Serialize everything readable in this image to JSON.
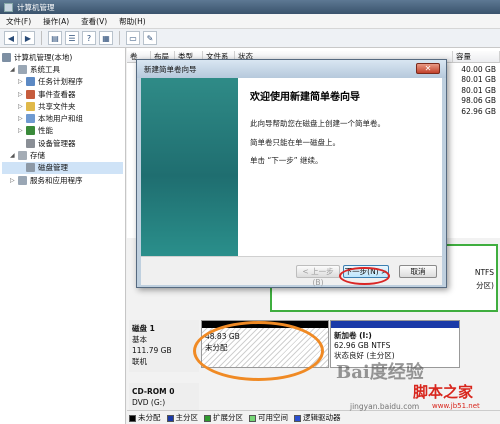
{
  "window": {
    "title": "计算机管理"
  },
  "menu": [
    "文件(F)",
    "操作(A)",
    "查看(V)",
    "帮助(H)"
  ],
  "toolbar": {
    "icons": [
      "back-icon",
      "forward-icon",
      "folder-up-icon",
      "list-icon",
      "help-icon",
      "properties-icon",
      "disk-icon",
      "connect-icon"
    ]
  },
  "tree": {
    "root": "计算机管理(本地)",
    "system_tools": "系统工具",
    "task_scheduler": "任务计划程序",
    "event_viewer": "事件查看器",
    "shared_folders": "共享文件夹",
    "local_users": "本地用户和组",
    "performance": "性能",
    "device_manager": "设备管理器",
    "storage": "存储",
    "disk_management": "磁盘管理",
    "services_apps": "服务和应用程序"
  },
  "columns": [
    "卷",
    "布局",
    "类型",
    "文件系统",
    "状态",
    "容量"
  ],
  "capacities": [
    "40.00 GB",
    "80.01 GB",
    "80.01 GB",
    "98.06 GB",
    "62.96 GB"
  ],
  "wizard": {
    "title": "新建简单卷向导",
    "close": "✕",
    "heading": "欢迎使用新建简单卷向导",
    "p1": "此向导帮助您在磁盘上创建一个简单卷。",
    "p2": "简单卷只能在单一磁盘上。",
    "p3": "单击 “下一步” 继续。",
    "back": "< 上一步(B)",
    "next": "下一步(N) >",
    "cancel": "取消"
  },
  "disk1": {
    "name": "磁盘 1",
    "type": "基本",
    "size": "111.79 GB",
    "status": "联机",
    "unalloc_size": "48.83 GB",
    "unalloc_label": "未分配",
    "vol_name": "新加卷 (I:)",
    "vol_fs": "62.96 GB NTFS",
    "vol_status": "状态良好 (主分区)"
  },
  "partial_labels": {
    "ntfs": "NTFS",
    "status": "分区)"
  },
  "cdrom": {
    "name": "CD-ROM 0",
    "drive": "DVD (G:)"
  },
  "legend": [
    {
      "label": "未分配",
      "color": "#000000"
    },
    {
      "label": "主分区",
      "color": "#1b3aa8"
    },
    {
      "label": "扩展分区",
      "color": "#2f9b2f"
    },
    {
      "label": "可用空间",
      "color": "#76d676"
    },
    {
      "label": "逻辑驱动器",
      "color": "#2a4fd0"
    }
  ],
  "watermark": {
    "baidu": "Bai度经验",
    "jb51": "脚本之家",
    "url1": "jingyan.baidu.com",
    "url2": "www.jb51.net"
  }
}
